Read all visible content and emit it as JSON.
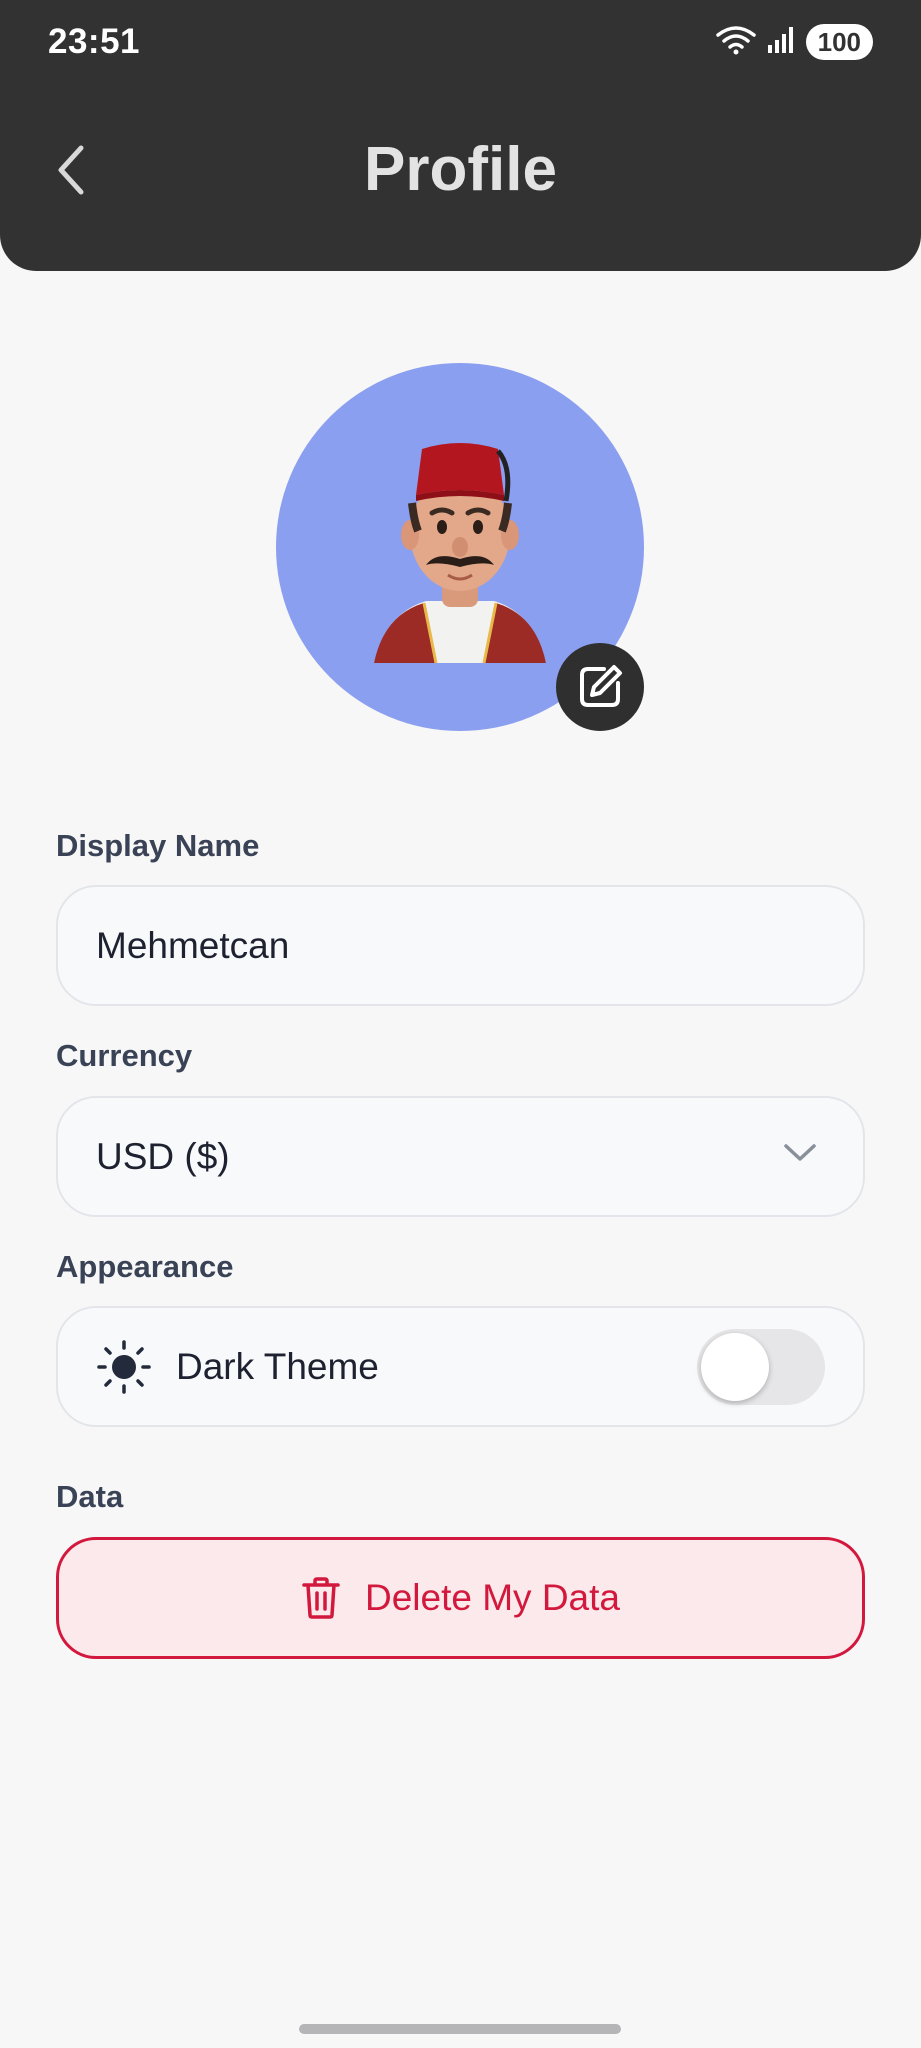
{
  "status_bar": {
    "time": "23:51",
    "battery": "100",
    "icons": [
      "wifi-icon",
      "signal-icon",
      "battery-icon"
    ]
  },
  "header": {
    "title": "Profile",
    "back_icon": "chevron-left-icon"
  },
  "avatar": {
    "edit_icon": "edit-icon",
    "background_color": "#8b9ff0"
  },
  "display_name": {
    "label": "Display Name",
    "value": "Mehmetcan"
  },
  "currency": {
    "label": "Currency",
    "selected": "USD ($)"
  },
  "appearance": {
    "label": "Appearance",
    "dark_theme_label": "Dark Theme",
    "dark_theme_enabled": false,
    "icon": "sun-icon"
  },
  "data_section": {
    "label": "Data",
    "delete_label": "Delete My Data",
    "delete_icon": "trash-icon",
    "accent_color": "#d3183d"
  }
}
